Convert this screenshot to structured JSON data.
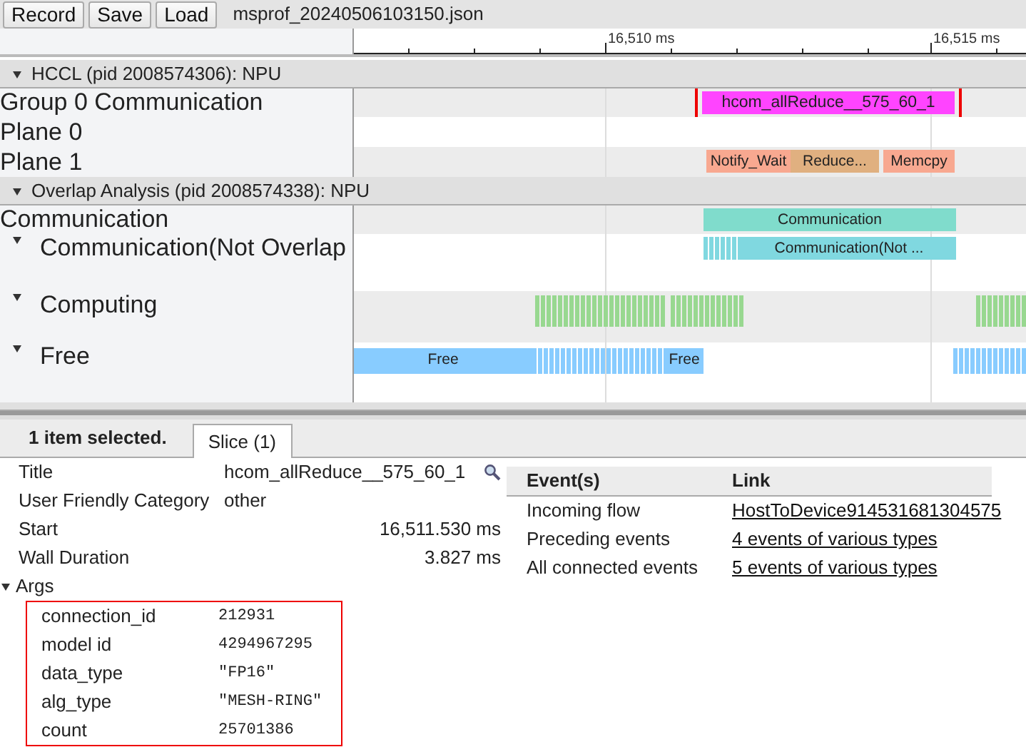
{
  "toolbar": {
    "buttons": [
      "Record",
      "Save",
      "Load"
    ],
    "filename": "msprof_20240506103150.json"
  },
  "ruler": {
    "ticks": [
      "16,510 ms",
      "16,515 ms"
    ]
  },
  "processes": [
    {
      "title": "HCCL (pid 2008574306): NPU",
      "expanded": true,
      "tracks": [
        {
          "name": "Group 0 Communication",
          "slices": [
            {
              "label": "hcom_allReduce__575_60_1",
              "color": "#ff44ff",
              "selected": true
            }
          ]
        },
        {
          "name": "Plane 0"
        },
        {
          "name": "Plane 1",
          "slices": [
            {
              "label": "Notify_Wait",
              "color": "#f8a890",
              "selected": false
            },
            {
              "label": "Reduce...",
              "color": "#e0b080",
              "selected": false
            },
            {
              "label": "Memcpy",
              "color": "#f8a890",
              "selected": false
            }
          ]
        }
      ]
    },
    {
      "title": "Overlap Analysis (pid 2008574338): NPU",
      "expanded": true,
      "tracks": [
        {
          "name": "Communication",
          "slices": [
            {
              "label": "Communication",
              "color": "#80dccc",
              "selected": false
            }
          ]
        },
        {
          "name": "Communication(Not Overlap",
          "expanded": true,
          "slices": [
            {
              "label": "Communication(Not ...",
              "color": "#80d8e0",
              "selected": false
            }
          ]
        },
        {
          "name": "Computing",
          "expanded": true
        },
        {
          "name": "Free",
          "expanded": true,
          "slices": [
            {
              "label": "Free",
              "color": "#88ccff",
              "selected": false
            },
            {
              "label": "Free",
              "color": "#88ccff",
              "selected": false
            }
          ]
        }
      ]
    }
  ],
  "panel": {
    "summary": "1 item selected.",
    "tabs": [
      {
        "label": "Slice (1)",
        "selected": true
      }
    ],
    "details": [
      {
        "label": "Title",
        "value": "hcom_allReduce__575_60_1",
        "kind": "search"
      },
      {
        "label": "User Friendly Category",
        "value": "other",
        "kind": "text"
      },
      {
        "label": "Start",
        "value": "16,511.530 ms",
        "kind": "number"
      },
      {
        "label": "Wall Duration",
        "value": "3.827 ms",
        "kind": "number"
      }
    ],
    "args": {
      "label": "Args",
      "expanded": true,
      "highlighted": true,
      "rows": [
        {
          "label": "connection_id",
          "value": "212931"
        },
        {
          "label": "model id",
          "value": "4294967295"
        },
        {
          "label": "data_type",
          "value": "\"FP16\""
        },
        {
          "label": "alg_type",
          "value": "\"MESH-RING\""
        },
        {
          "label": "count",
          "value": "25701386"
        }
      ]
    },
    "events": {
      "columns": [
        "Event(s)",
        "Link"
      ],
      "rows": [
        {
          "event": "Incoming flow",
          "link": "HostToDevice914531681304575"
        },
        {
          "event": "Preceding events",
          "link": "4 events of various types"
        },
        {
          "event": "All connected events",
          "link": "5 events of various types"
        }
      ]
    }
  }
}
